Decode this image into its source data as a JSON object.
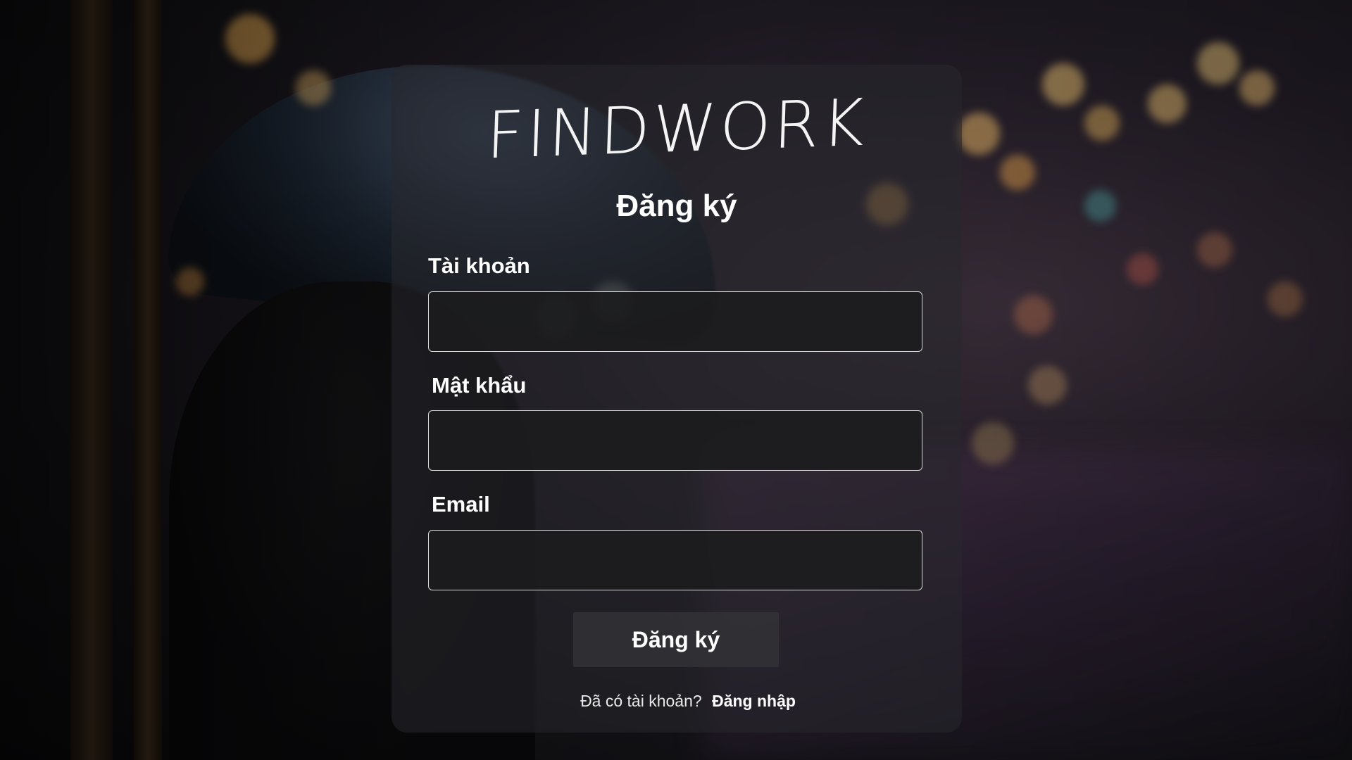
{
  "brand": {
    "logo_text": "FINDWORK"
  },
  "form": {
    "title": "Đăng ký",
    "fields": [
      {
        "label": "Tài khoản",
        "value": "",
        "placeholder": ""
      },
      {
        "label": "Mật khẩu",
        "value": "",
        "placeholder": ""
      },
      {
        "label": "Email",
        "value": "",
        "placeholder": ""
      }
    ],
    "submit_label": "Đăng ký"
  },
  "footer": {
    "prompt_text": "Đã có tài khoản?",
    "login_link": "Đăng nhập"
  },
  "colors": {
    "panel": "#28282e",
    "input_background": "#1c1c1e",
    "input_border": "#d8d8d8",
    "text": "#ffffff"
  }
}
